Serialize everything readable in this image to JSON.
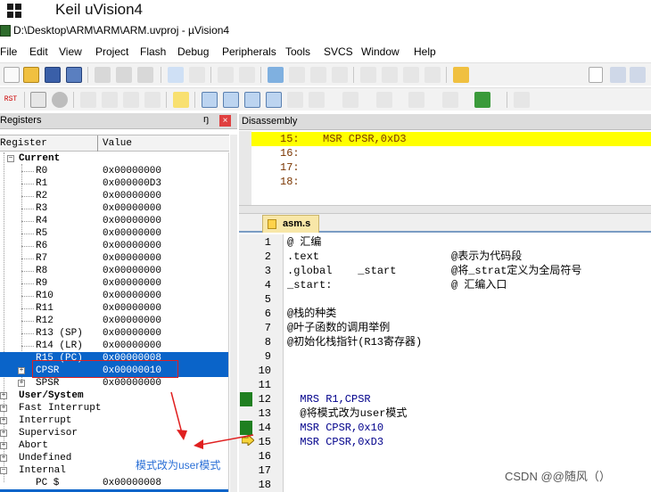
{
  "caption": {
    "title": "Keil uVision4"
  },
  "window": {
    "title": "D:\\Desktop\\ARM\\ARM\\ARM.uvproj - µVision4"
  },
  "menu": [
    "File",
    "Edit",
    "View",
    "Project",
    "Flash",
    "Debug",
    "Peripherals",
    "Tools",
    "SVCS",
    "Window",
    "Help"
  ],
  "toolbar2": {
    "rst_label": "RST"
  },
  "registers": {
    "panel_title": "Registers",
    "pin_glyph": "ŋ",
    "col_register": "Register",
    "col_value": "Value",
    "group_current": "Current",
    "rows": [
      {
        "name": "R0",
        "value": "0x00000000"
      },
      {
        "name": "R1",
        "value": "0x000000D3"
      },
      {
        "name": "R2",
        "value": "0x00000000"
      },
      {
        "name": "R3",
        "value": "0x00000000"
      },
      {
        "name": "R4",
        "value": "0x00000000"
      },
      {
        "name": "R5",
        "value": "0x00000000"
      },
      {
        "name": "R6",
        "value": "0x00000000"
      },
      {
        "name": "R7",
        "value": "0x00000000"
      },
      {
        "name": "R8",
        "value": "0x00000000"
      },
      {
        "name": "R9",
        "value": "0x00000000"
      },
      {
        "name": "R10",
        "value": "0x00000000"
      },
      {
        "name": "R11",
        "value": "0x00000000"
      },
      {
        "name": "R12",
        "value": "0x00000000"
      },
      {
        "name": "R13 (SP)",
        "value": "0x00000000"
      },
      {
        "name": "R14 (LR)",
        "value": "0x00000000"
      },
      {
        "name": "R15 (PC)",
        "value": "0x00000008"
      },
      {
        "name": "CPSR",
        "value": "0x00000010"
      },
      {
        "name": "SPSR",
        "value": "0x00000000"
      }
    ],
    "groups": [
      "User/System",
      "Fast Interrupt",
      "Interrupt",
      "Supervisor",
      "Abort",
      "Undefined",
      "Internal"
    ],
    "internal_pc": {
      "name": "PC  $",
      "value": "0x00000008"
    }
  },
  "disassembly": {
    "panel_title": "Disassembly",
    "lines": [
      {
        "num": "15:",
        "text": "MSR CPSR,0xD3",
        "highlight": true
      },
      {
        "num": "16:",
        "text": "",
        "highlight": false
      },
      {
        "num": "17:",
        "text": "",
        "highlight": false
      },
      {
        "num": "18:",
        "text": "",
        "highlight": false
      }
    ]
  },
  "editor": {
    "tab_label": "asm.s",
    "lines": [
      {
        "num": "1",
        "code": "@ 汇编",
        "comment": ""
      },
      {
        "num": "2",
        "code": ".text",
        "comment": "@表示为代码段"
      },
      {
        "num": "3",
        "code": ".global    _start",
        "comment": "@将_strat定义为全局符号"
      },
      {
        "num": "4",
        "code": "_start:",
        "comment": "@ 汇编入口"
      },
      {
        "num": "5",
        "code": "",
        "comment": ""
      },
      {
        "num": "6",
        "code": "@栈的种类",
        "comment": ""
      },
      {
        "num": "7",
        "code": "@叶子函数的调用举例",
        "comment": ""
      },
      {
        "num": "8",
        "code": "@初始化栈指针(R13寄存器)",
        "comment": ""
      },
      {
        "num": "9",
        "code": "",
        "comment": ""
      },
      {
        "num": "10",
        "code": "",
        "comment": ""
      },
      {
        "num": "11",
        "code": "",
        "comment": ""
      },
      {
        "num": "12",
        "code": "  MRS R1,CPSR",
        "comment": ""
      },
      {
        "num": "13",
        "code": "  @将模式改为user模式",
        "comment": ""
      },
      {
        "num": "14",
        "code": "  MSR CPSR,0x10",
        "comment": ""
      },
      {
        "num": "15",
        "code": "  MSR CPSR,0xD3",
        "comment": ""
      },
      {
        "num": "16",
        "code": "",
        "comment": ""
      },
      {
        "num": "17",
        "code": "",
        "comment": ""
      },
      {
        "num": "18",
        "code": "",
        "comment": ""
      }
    ]
  },
  "annotation": {
    "note": "模式改为user模式"
  },
  "watermark": "CSDN @@随风（）",
  "colors": {
    "selection": "#0a64c9",
    "highlight": "#ffff00",
    "annotation_red": "#e02020",
    "note_blue": "#2a6fd6",
    "exec_bar": "#1f7f20"
  }
}
